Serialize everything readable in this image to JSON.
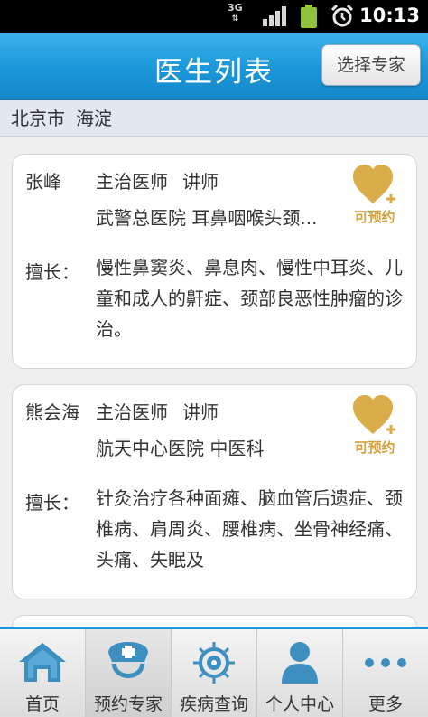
{
  "status_bar": {
    "network": "3G",
    "time": "10:13"
  },
  "header": {
    "title": "医生列表",
    "select_expert_label": "选择专家"
  },
  "location": {
    "city": "北京市",
    "district": "海淀"
  },
  "doctors": [
    {
      "name": "张峰",
      "rank": "主治医师",
      "teaching": "讲师",
      "hospital": "武警总医院 耳鼻咽喉头颈...",
      "specialty_label": "擅长：",
      "specialty": "慢性鼻窦炎、鼻息肉、慢性中耳炎、儿童和成人的鼾症、颈部良恶性肿瘤的诊治。",
      "book_label": "可预约",
      "book_icon": "heart-plus-icon"
    },
    {
      "name": "熊会海",
      "rank": "主治医师",
      "teaching": "讲师",
      "hospital": "航天中心医院 中医科",
      "specialty_label": "擅长：",
      "specialty": "针灸治疗各种面瘫、脑血管后遗症、颈椎病、肩周炎、腰椎病、坐骨神经痛、头痛、失眠及",
      "book_label": "可预约",
      "book_icon": "heart-plus-icon"
    }
  ],
  "bottom_nav": [
    {
      "label": "首页",
      "icon": "home-icon"
    },
    {
      "label": "预约专家",
      "icon": "nurse-cap-icon"
    },
    {
      "label": "疾病查询",
      "icon": "virus-icon"
    },
    {
      "label": "个人中心",
      "icon": "person-icon"
    },
    {
      "label": "更多",
      "icon": "more-dots-icon"
    }
  ],
  "colors": {
    "header_blue": "#1a97d8",
    "book_gold": "#d4a33a",
    "nav_icon_blue": "#3d8fc0"
  }
}
